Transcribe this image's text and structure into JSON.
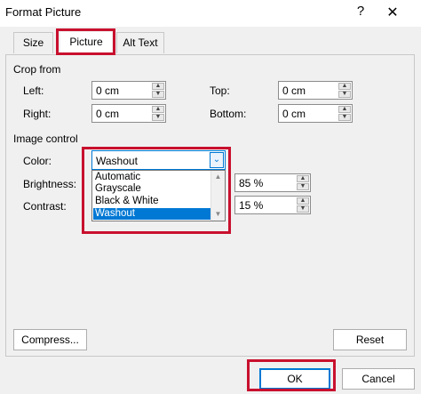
{
  "window": {
    "title": "Format Picture",
    "help_glyph": "?",
    "close_glyph": "✕"
  },
  "tabs": [
    {
      "label": "Size"
    },
    {
      "label": "Picture",
      "selected": true
    },
    {
      "label": "Alt Text"
    }
  ],
  "crop": {
    "section_label": "Crop from",
    "left": {
      "label": "Left:",
      "value": "0 cm"
    },
    "right": {
      "label": "Right:",
      "value": "0 cm"
    },
    "top": {
      "label": "Top:",
      "value": "0 cm"
    },
    "bottom": {
      "label": "Bottom:",
      "value": "0 cm"
    }
  },
  "image_control": {
    "section_label": "Image control",
    "color": {
      "label": "Color:",
      "value": "Washout",
      "options": [
        "Automatic",
        "Grayscale",
        "Black & White",
        "Washout"
      ],
      "selected_index": 3
    },
    "brightness": {
      "label": "Brightness:",
      "value": "85 %"
    },
    "contrast": {
      "label": "Contrast:",
      "value": "15 %"
    }
  },
  "buttons": {
    "compress": "Compress...",
    "reset": "Reset",
    "ok": "OK",
    "cancel": "Cancel"
  },
  "colors": {
    "accent": "#0078d4",
    "highlight_box": "#c8102e"
  }
}
